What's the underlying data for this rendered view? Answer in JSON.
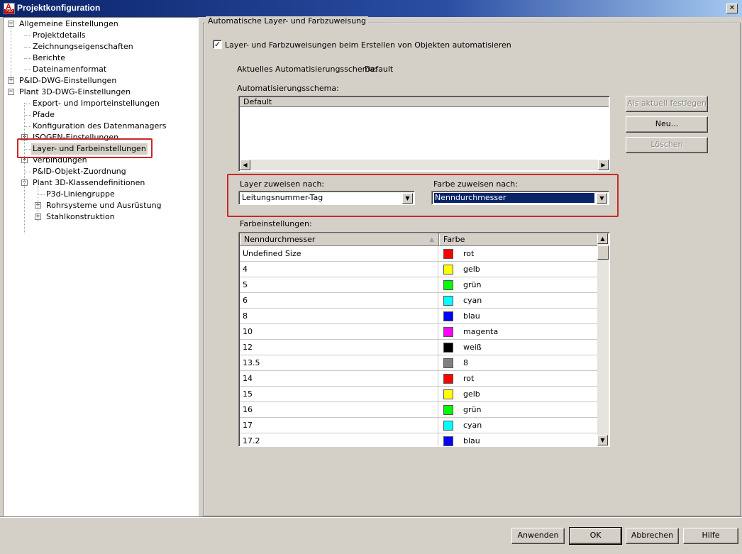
{
  "window": {
    "title": "Projektkonfiguration",
    "close_glyph": "✕"
  },
  "tree": {
    "items": [
      {
        "label": "Allgemeine Einstellungen",
        "toggle": "−"
      },
      {
        "label": "Projektdetails"
      },
      {
        "label": "Zeichnungseigenschaften"
      },
      {
        "label": "Berichte"
      },
      {
        "label": "Dateinamenformat"
      },
      {
        "label": "P&ID-DWG-Einstellungen",
        "toggle": "+"
      },
      {
        "label": "Plant 3D-DWG-Einstellungen",
        "toggle": "−"
      },
      {
        "label": "Export- und Importeinstellungen"
      },
      {
        "label": "Pfade"
      },
      {
        "label": "Konfiguration des Datenmanagers"
      },
      {
        "label": "ISOGEN-Einstellungen",
        "toggle": "+"
      },
      {
        "label": "Layer- und Farbeinstellungen",
        "selected": true
      },
      {
        "label": "Verbindungen",
        "toggle": "+"
      },
      {
        "label": "P&ID-Objekt-Zuordnung"
      },
      {
        "label": "Plant 3D-Klassendefinitionen",
        "toggle": "−"
      },
      {
        "label": "P3d-Liniengruppe"
      },
      {
        "label": "Rohrsysteme und Ausrüstung",
        "toggle": "+"
      },
      {
        "label": "Stahlkonstruktion",
        "toggle": "+"
      }
    ]
  },
  "group": {
    "title": "Automatische Layer- und Farbzuweisung",
    "auto_checkbox_label": "Layer- und Farbzuweisungen beim Erstellen von Objekten automatisieren",
    "auto_checked_glyph": "✓",
    "current_schema_label": "Aktuelles Automatisierungsschema:",
    "current_schema_value": "Default",
    "schema_list_label": "Automatisierungsschema:",
    "schema_list": {
      "header": "Default",
      "items": []
    },
    "buttons": {
      "set_current": "Als aktuell festlegen",
      "new": "Neu...",
      "delete": "Löschen"
    },
    "layer_assign_label": "Layer zuweisen nach:",
    "layer_assign_value": "Leitungsnummer-Tag",
    "color_assign_label": "Farbe zuweisen nach:",
    "color_assign_value": "Nenndurchmesser",
    "color_settings_label": "Farbeinstellungen:",
    "grid": {
      "headers": [
        "Nenndurchmesser",
        "Farbe"
      ],
      "sort_glyph": "▲",
      "rows": [
        {
          "size": "Undefined Size",
          "color": "rot",
          "hex": "#ff0000"
        },
        {
          "size": "4",
          "color": "gelb",
          "hex": "#ffff00"
        },
        {
          "size": "5",
          "color": "grün",
          "hex": "#00ff00"
        },
        {
          "size": "6",
          "color": "cyan",
          "hex": "#00ffff"
        },
        {
          "size": "8",
          "color": "blau",
          "hex": "#0000ff"
        },
        {
          "size": "10",
          "color": "magenta",
          "hex": "#ff00ff"
        },
        {
          "size": "12",
          "color": "weiß",
          "hex": "#000000"
        },
        {
          "size": "13.5",
          "color": "8",
          "hex": "#808080"
        },
        {
          "size": "14",
          "color": "rot",
          "hex": "#ff0000"
        },
        {
          "size": "15",
          "color": "gelb",
          "hex": "#ffff00"
        },
        {
          "size": "16",
          "color": "grün",
          "hex": "#00ff00"
        },
        {
          "size": "17",
          "color": "cyan",
          "hex": "#00ffff"
        },
        {
          "size": "17.2",
          "color": "blau",
          "hex": "#0000ff"
        }
      ]
    }
  },
  "footer": {
    "apply": "Anwenden",
    "ok": "OK",
    "cancel": "Abbrechen",
    "help": "Hilfe"
  },
  "glyphs": {
    "arrow_down": "▼",
    "arrow_up": "▲",
    "arrow_left": "◀",
    "arrow_right": "▶"
  }
}
